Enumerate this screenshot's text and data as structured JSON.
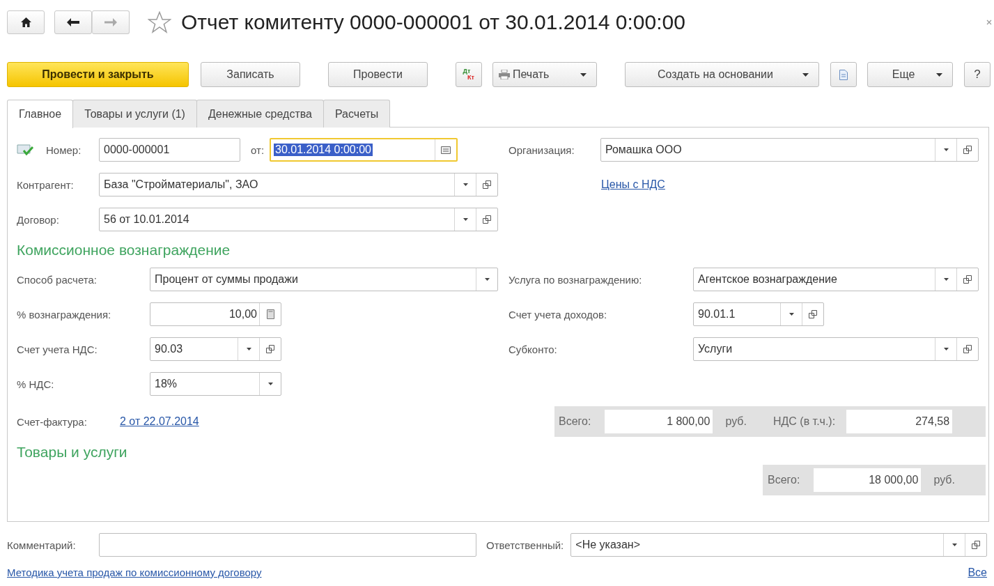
{
  "header": {
    "title": "Отчет комитенту 0000-000001 от 30.01.2014 0:00:00",
    "favorite": false
  },
  "toolbar": [
    {
      "kind": "primary",
      "label": "Провести и закрыть"
    },
    {
      "kind": "button",
      "label": "Записать"
    },
    {
      "kind": "button",
      "label": "Провести"
    },
    {
      "kind": "dtkt",
      "label": "Дт",
      "label2": "Кт"
    },
    {
      "kind": "print",
      "label": "Печать"
    },
    {
      "kind": "menu",
      "label": "Создать на основании"
    },
    {
      "kind": "report"
    },
    {
      "kind": "menu",
      "label": "Еще"
    },
    {
      "kind": "button",
      "label": "?"
    }
  ],
  "tabs": [
    {
      "label": "Главное",
      "selected": true
    },
    {
      "label": "Товары и услуги (1)",
      "selected": false
    },
    {
      "label": "Денежные средства",
      "selected": false
    },
    {
      "label": "Расчеты",
      "selected": false
    }
  ],
  "form": {
    "number": {
      "label": "Номер:",
      "value": "0000-000001"
    },
    "date": {
      "label": "от:",
      "value": "30.01.2014  0:00:00",
      "focused": true,
      "calendar": true
    },
    "organization": {
      "label": "Организация:",
      "value": "Ромашка ООО",
      "dropdown": true,
      "open": true
    },
    "counterparty": {
      "label": "Контрагент:",
      "value": "База \"Стройматериалы\", ЗАО",
      "dropdown": true,
      "open": true
    },
    "prices_link": "Цены с НДС",
    "contract": {
      "label": "Договор:",
      "value": "56 от 10.01.2014",
      "dropdown": true,
      "open": true
    },
    "commission": {
      "title": "Комиссионное вознаграждение",
      "method": {
        "label": "Способ расчета:",
        "value": "Процент от суммы продажи",
        "dropdown": true,
        "open": false
      },
      "service": {
        "label": "Услуга по вознаграждению:",
        "value": "Агентское вознаграждение",
        "dropdown": true,
        "open": true
      },
      "percent": {
        "label": "% вознаграждения:",
        "value": "10,00",
        "calculator": true
      },
      "income_account": {
        "label": "Счет учета доходов:",
        "value": "90.01.1",
        "dropdown": true,
        "open": true
      },
      "vat_account": {
        "label": "Счет учета НДС:",
        "value": "90.03",
        "dropdown": true,
        "open": true
      },
      "subconto": {
        "label": "Субконто:",
        "value": "Услуги",
        "dropdown": true,
        "open": true
      },
      "vat_rate": {
        "label": "% НДС:",
        "value": "18%",
        "dropdown": true,
        "open": false
      },
      "invoice": {
        "label": "Счет-фактура:",
        "link": "2 от 22.07.2014"
      },
      "totals": {
        "total_label": "Всего:",
        "total": "1 800,00",
        "currency": "руб.",
        "vat_label": "НДС (в т.ч.):",
        "vat": "274,58"
      }
    },
    "goods": {
      "title": "Товары и услуги",
      "total_label": "Всего:",
      "total": "18 000,00",
      "currency": "руб."
    }
  },
  "footer": {
    "comment": {
      "label": "Комментарий:"
    },
    "responsible": {
      "label": "Ответственный:",
      "value": "<Не указан>",
      "dropdown": true,
      "open": true
    },
    "method_link": "Методика учета продаж по комиссионному договору",
    "all_link": "Все"
  }
}
